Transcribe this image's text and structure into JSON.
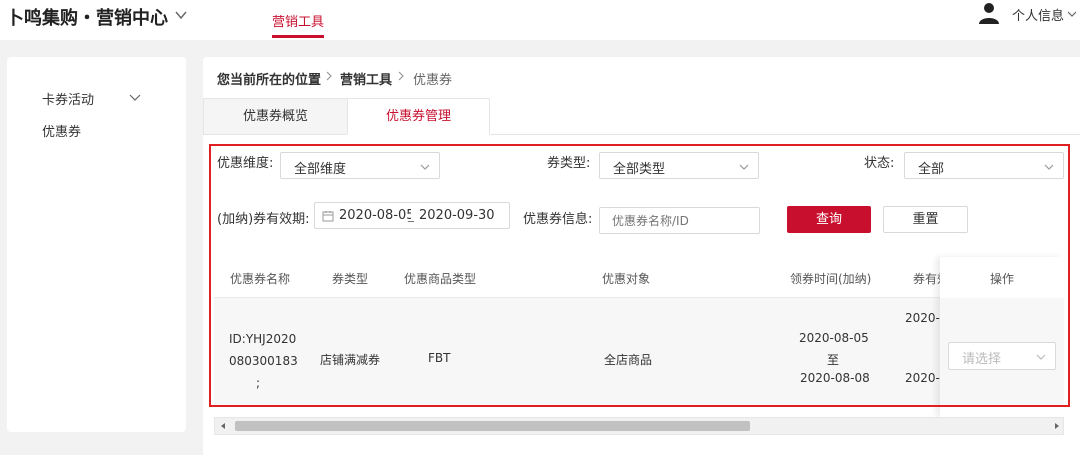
{
  "app": {
    "title": "卜鸣集购・营销中心",
    "nav_tab": "营销工具",
    "user_label": "个人信息"
  },
  "sidebar": {
    "items": [
      {
        "label": "卡券活动"
      },
      {
        "label": "优惠券"
      }
    ]
  },
  "breadcrumb": {
    "items": [
      "您当前所在的位置",
      "营销工具",
      "优惠券"
    ]
  },
  "tabs": [
    {
      "label": "优惠券概览",
      "active": false
    },
    {
      "label": "优惠券管理",
      "active": true
    }
  ],
  "filters": {
    "dimension_label": "优惠维度:",
    "dimension_value": "全部维度",
    "coupon_type_label": "券类型:",
    "coupon_type_value": "全部类型",
    "status_label": "状态:",
    "status_value": "全部",
    "validity_label": "(加纳)券有效期:",
    "date_start": "2020-08-05",
    "date_end": "2020-09-30",
    "info_label": "优惠券信息:",
    "info_placeholder": "优惠券名称/ID",
    "query_button": "查询",
    "reset_button": "重置"
  },
  "table": {
    "columns": [
      "优惠券名称",
      "券类型",
      "优惠商品类型",
      "优惠对象",
      "领券时间(加纳)",
      "券有效",
      "操作"
    ],
    "rows": [
      {
        "name_line1": "ID:YHJ2020",
        "name_line2": "080300183",
        "name_line3": ";",
        "type": "店铺满减券",
        "goods_type": "FBT",
        "target": "全店商品",
        "claim_start": "2020-08-05",
        "claim_sep": "至",
        "claim_end": "2020-08-08",
        "valid_start": "2020-",
        "valid_end": "2020-",
        "action_placeholder": "请选择"
      }
    ]
  },
  "colors": {
    "accent": "#c8102e",
    "highlight_border": "#e02020"
  }
}
